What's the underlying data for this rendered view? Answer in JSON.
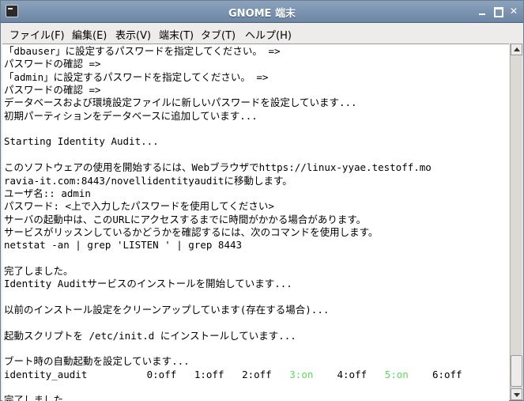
{
  "window": {
    "title": "GNOME 端末",
    "buttons": {
      "minimize": "_",
      "maximize": "□",
      "close": "✕"
    }
  },
  "menubar": {
    "items": [
      {
        "label": "ファイル(F)"
      },
      {
        "label": "編集(E)"
      },
      {
        "label": "表示(V)"
      },
      {
        "label": "端末(T)"
      },
      {
        "label": "タブ(T)"
      },
      {
        "label": "ヘルプ(H)"
      }
    ]
  },
  "terminal": {
    "lines": [
      "「dbauser」に設定するパスワードを指定してください。 =>",
      "パスワードの確認 =>",
      "「admin」に設定するパスワードを指定してください。 =>",
      "パスワードの確認 =>",
      "データベースおよび環境設定ファイルに新しいパスワードを設定しています...",
      "初期パーティションをデータベースに追加しています...",
      "",
      "Starting Identity Audit...",
      "",
      "このソフトウェアの使用を開始するには、Webブラウザでhttps://linux-yyae.testoff.mo",
      "ravia-it.com:8443/novellidentityauditに移動します。",
      "ユーザ名:: admin",
      "パスワード: <上で入力したパスワードを使用してください>",
      "サーバの起動中は、このURLにアクセスするまでに時間がかかる場合があります。",
      "サービスがリッスンしているかどうかを確認するには、次のコマンドを使用します。",
      "netstat -an | grep 'LISTEN ' | grep 8443",
      "",
      "完了しました。",
      "Identity Auditサービスのインストールを開始しています...",
      "",
      "以前のインストール設定をクリーンアップしています(存在する場合)...",
      "",
      "起動スクリプトを /etc/init.d にインストールしています...",
      "",
      "ブート時の自動起動を設定しています...",
      "",
      "",
      "完了しました。"
    ],
    "chkconfig": {
      "service": "identity_audit",
      "levels": [
        "0:off",
        "1:off",
        "2:off",
        "3:on",
        "4:off",
        "5:on",
        "6:off"
      ]
    },
    "colors": {
      "on": "#5ad85a",
      "fg": "#000000",
      "bg": "#ffffff"
    }
  }
}
